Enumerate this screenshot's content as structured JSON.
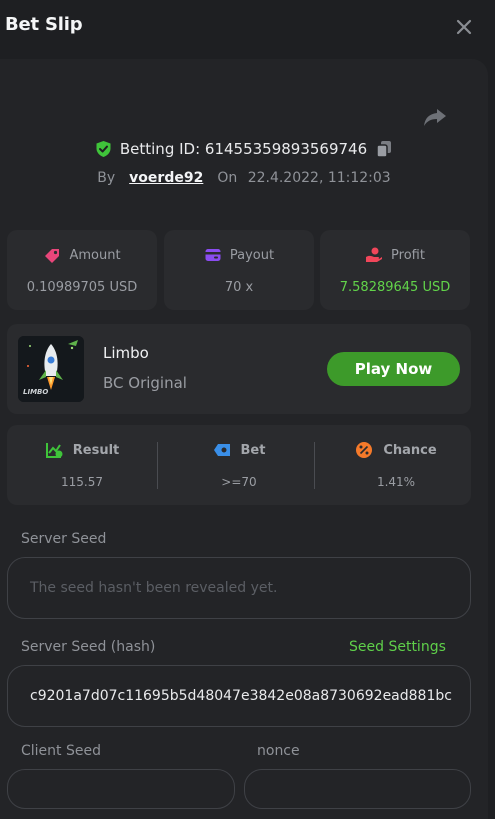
{
  "header": {
    "title": "Bet Slip"
  },
  "bet": {
    "id_label": "Betting ID: 61455359893569746",
    "by_label": "By",
    "user": "voerde92",
    "on_label": "On",
    "datetime": "22.4.2022, 11:12:03"
  },
  "stats": {
    "amount": {
      "label": "Amount",
      "value": "0.10989705 USD"
    },
    "payout": {
      "label": "Payout",
      "value": "70 x"
    },
    "profit": {
      "label": "Profit",
      "value": "7.58289645 USD"
    }
  },
  "game": {
    "name": "Limbo",
    "subtitle": "BC Original",
    "play_label": "Play Now",
    "thumb_text": "LIMBO"
  },
  "result": {
    "result": {
      "label": "Result",
      "value": "115.57"
    },
    "bet": {
      "label": "Bet",
      "value": ">=70"
    },
    "chance": {
      "label": "Chance",
      "value": "1.41%"
    }
  },
  "seeds": {
    "server_seed_label": "Server Seed",
    "server_seed_placeholder": "The seed hasn't been revealed yet.",
    "server_hash_label": "Server Seed (hash)",
    "seed_settings_label": "Seed Settings",
    "server_hash_value": "c9201a7d07c11695b5d48047e3842e08a8730692ead881bc",
    "client_seed_label": "Client Seed",
    "nonce_label": "nonce"
  },
  "colors": {
    "accent_green": "#3d9a2a",
    "profit_green": "#62d44a",
    "amount_icon": "#e8467a",
    "payout_icon": "#8a4cf0",
    "profit_icon": "#f0465a",
    "bet_icon": "#3a8fe8",
    "chance_icon": "#f57a2a"
  },
  "icons": [
    "close-icon",
    "share-icon",
    "shield-check-icon",
    "copy-icon",
    "amount-icon",
    "payout-icon",
    "profit-icon",
    "result-icon",
    "bet-icon",
    "chance-icon"
  ]
}
